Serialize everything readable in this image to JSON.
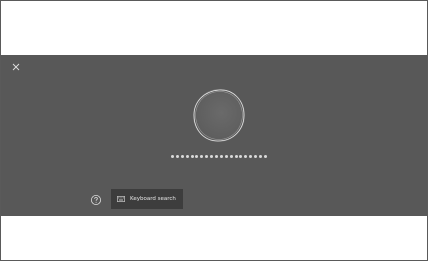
{
  "panel": {
    "background": "#585858",
    "close_icon": "close-icon",
    "orb_icon": "listening-orb-icon",
    "dots_count": 20,
    "help_icon": "question-mark-icon"
  },
  "keyboard_search": {
    "icon": "keyboard-icon",
    "label": "Keyboard search"
  }
}
